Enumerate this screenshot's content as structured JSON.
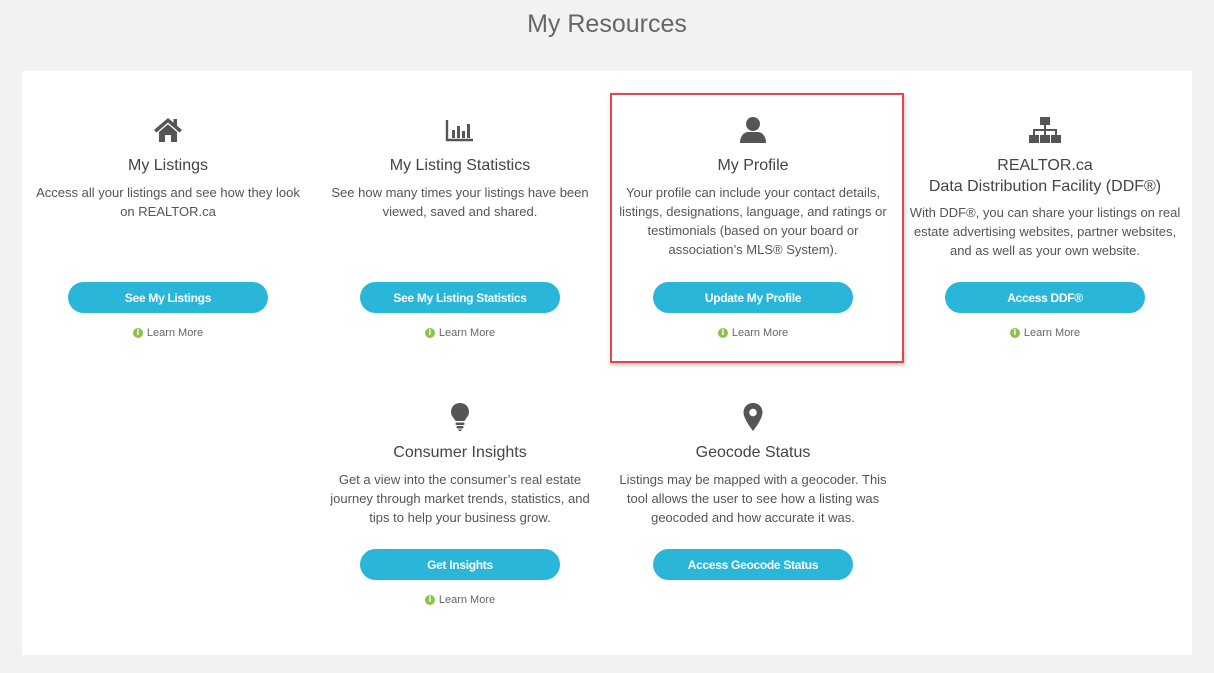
{
  "page_title": "My Resources",
  "cards": [
    {
      "id": "listings",
      "icon": "home-icon",
      "title": "My Listings",
      "description": "Access all your listings and see how they look on REALTOR.ca",
      "button": "See My Listings",
      "learn_more": "Learn More"
    },
    {
      "id": "statistics",
      "icon": "bar-chart-icon",
      "title": "My Listing Statistics",
      "description": "See how many times your listings have been viewed, saved and shared.",
      "button": "See My Listing Statistics",
      "learn_more": "Learn More"
    },
    {
      "id": "profile",
      "icon": "user-icon",
      "title": "My Profile",
      "description": "Your profile can include your contact details, listings, designations, language, and ratings or testimonials (based on your board or association’s MLS® System).",
      "button": "Update My Profile",
      "learn_more": "Learn More",
      "highlighted": true
    },
    {
      "id": "ddf",
      "icon": "sitemap-icon",
      "title": "REALTOR.ca",
      "title_line2": "Data Distribution Facility (DDF®)",
      "description": "With DDF®, you can share your listings on real estate advertising websites, partner websites, and as well as your own website.",
      "button": "Access DDF®",
      "learn_more": "Learn More"
    },
    {
      "id": "insights",
      "icon": "lightbulb-icon",
      "title": "Consumer Insights",
      "description": "Get a view into the consumer’s real estate journey through market trends, statistics, and tips to help your business grow.",
      "button": "Get Insights",
      "learn_more": "Learn More"
    },
    {
      "id": "geocode",
      "icon": "map-marker-icon",
      "title": "Geocode Status",
      "description": "Listings may be mapped with a geocoder. This tool allows the user to see how a listing was geocoded and how accurate it was.",
      "button": "Access Geocode Status"
    }
  ],
  "colors": {
    "button": "#29b6d9",
    "info_icon": "#8bc34a",
    "highlight_border": "#e0464e",
    "icon": "#555555"
  }
}
